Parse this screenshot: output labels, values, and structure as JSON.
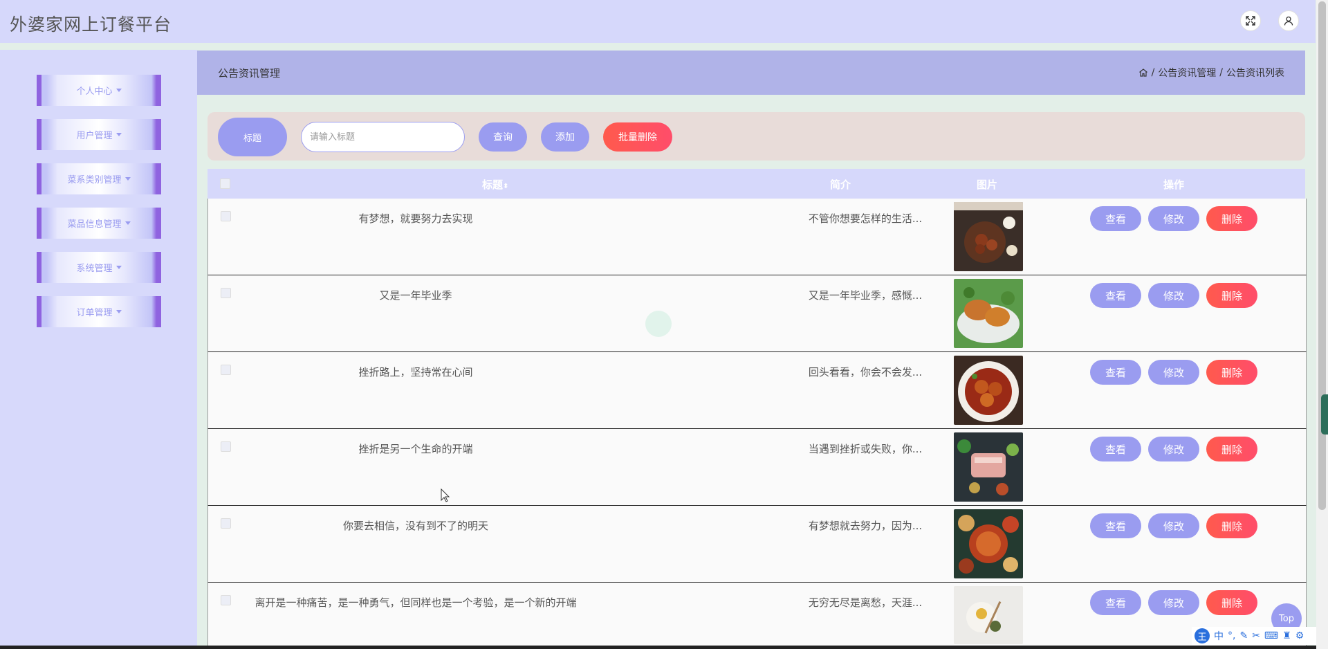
{
  "app": {
    "title": "外婆家网上订餐平台"
  },
  "topbar": {
    "fullscreen_icon": "expand-icon",
    "user_icon": "user-icon"
  },
  "sidebar": {
    "items": [
      {
        "label": "个人中心"
      },
      {
        "label": "用户管理"
      },
      {
        "label": "菜系类别管理"
      },
      {
        "label": "菜品信息管理"
      },
      {
        "label": "系统管理"
      },
      {
        "label": "订单管理"
      }
    ]
  },
  "header": {
    "title": "公告资讯管理",
    "breadcrumb": {
      "home_icon": "home-icon",
      "items": [
        "公告资讯管理",
        "公告资讯列表"
      ],
      "separator": "/"
    }
  },
  "search": {
    "label": "标题",
    "placeholder": "请输入标题",
    "value": "",
    "query_label": "查询",
    "add_label": "添加",
    "bulk_delete_label": "批量删除"
  },
  "table": {
    "columns": {
      "title": "标题",
      "intro": "简介",
      "image": "图片",
      "actions": "操作"
    },
    "rows": [
      {
        "title": "有梦想，就要努力去实现",
        "intro": "不管你想要怎样的生活..."
      },
      {
        "title": "又是一年毕业季",
        "intro": "又是一年毕业季，感慨..."
      },
      {
        "title": "挫折路上，坚持常在心间",
        "intro": "回头看看，你会不会发..."
      },
      {
        "title": "挫折是另一个生命的开端",
        "intro": "当遇到挫折或失败，你..."
      },
      {
        "title": "你要去相信，没有到不了的明天",
        "intro": "有梦想就去努力，因为..."
      },
      {
        "title": "离开是一种痛苦，是一种勇气，但同样也是一个考验，是一个新的开端",
        "intro": "无穷无尽是离愁，天涯..."
      }
    ],
    "actions": {
      "view": "查看",
      "edit": "修改",
      "delete": "删除"
    }
  },
  "floating": {
    "top_label": "Top"
  },
  "ime": {
    "logo": "王",
    "mode": "中"
  },
  "colors": {
    "accent": "#9a9cf0",
    "danger": "#ff4d5a",
    "sidebar_bg": "#d7d9fb",
    "topbar_bg": "#d6d8fb"
  }
}
